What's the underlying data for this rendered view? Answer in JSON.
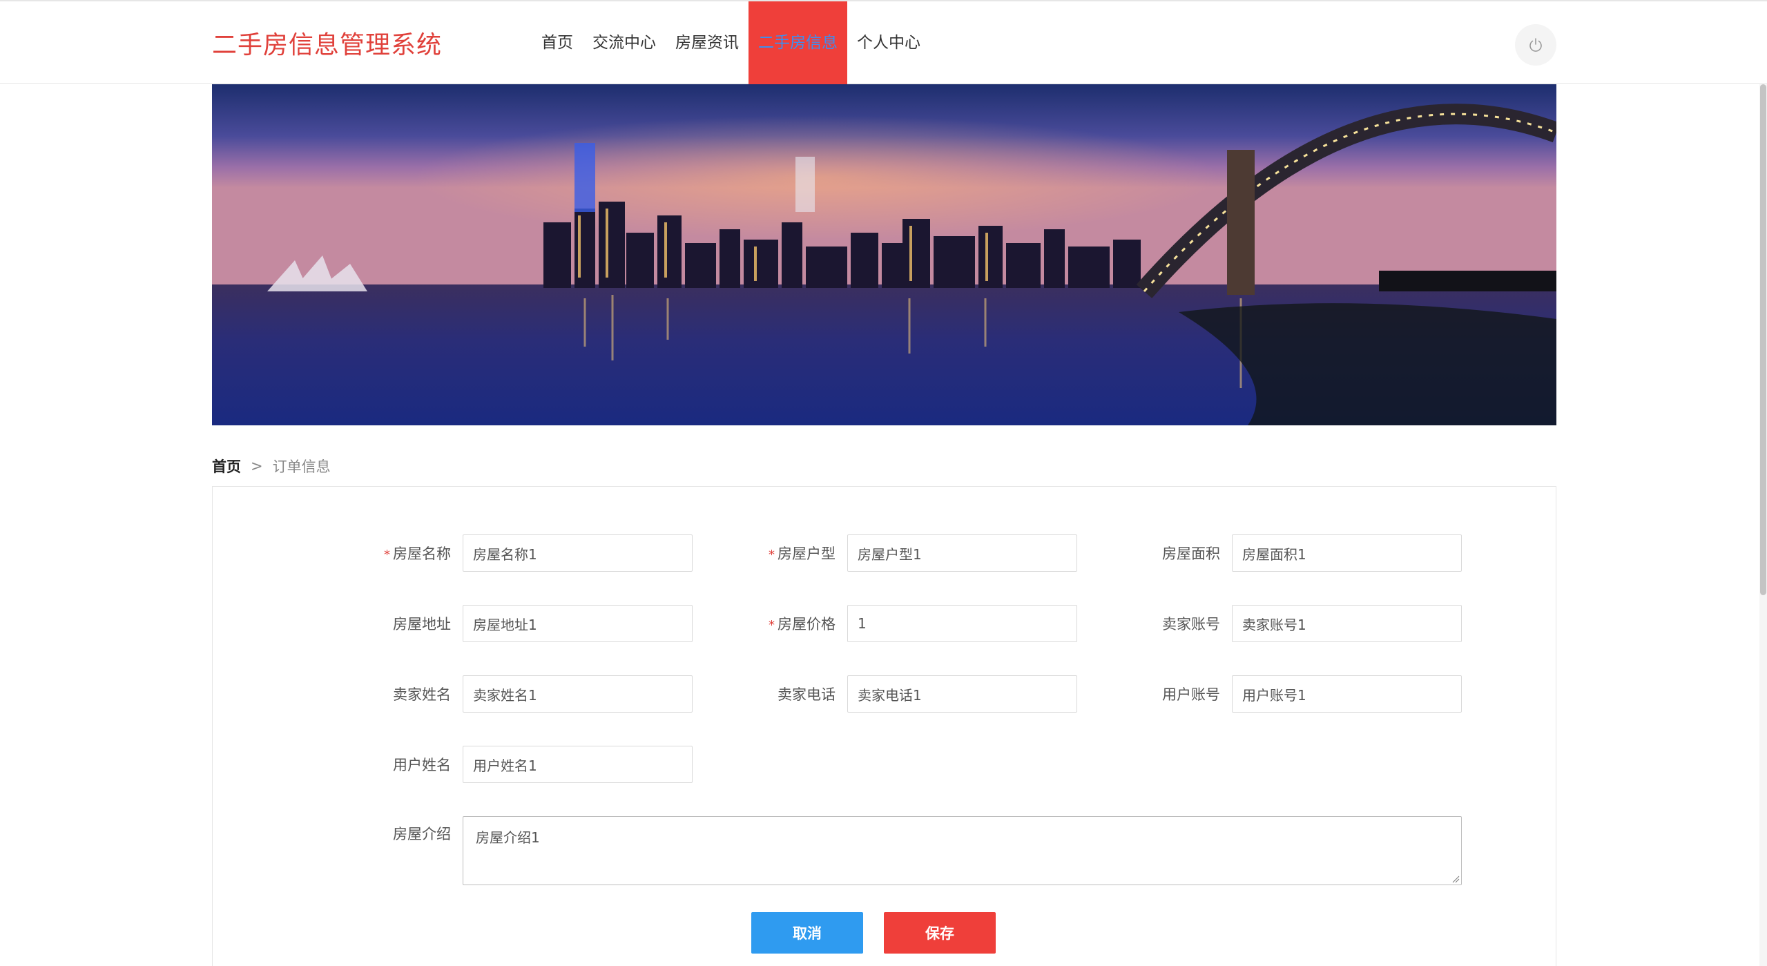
{
  "header": {
    "logo": "二手房信息管理系统",
    "nav": [
      {
        "label": "首页"
      },
      {
        "label": "交流中心"
      },
      {
        "label": "房屋资讯"
      },
      {
        "label": "二手房信息",
        "active": true
      },
      {
        "label": "个人中心"
      }
    ],
    "power_icon": "power-icon"
  },
  "banner": {
    "description_icon": "city-night-banner"
  },
  "breadcrumb": {
    "home": "首页",
    "separator": ">",
    "current": "订单信息"
  },
  "form": {
    "fields": [
      {
        "label": "房屋名称",
        "required": true,
        "value": "房屋名称1"
      },
      {
        "label": "房屋户型",
        "required": true,
        "value": "房屋户型1"
      },
      {
        "label": "房屋面积",
        "required": false,
        "value": "房屋面积1"
      },
      {
        "label": "房屋地址",
        "required": false,
        "value": "房屋地址1"
      },
      {
        "label": "房屋价格",
        "required": true,
        "value": "1"
      },
      {
        "label": "卖家账号",
        "required": false,
        "value": "卖家账号1"
      },
      {
        "label": "卖家姓名",
        "required": false,
        "value": "卖家姓名1"
      },
      {
        "label": "卖家电话",
        "required": false,
        "value": "卖家电话1"
      },
      {
        "label": "用户账号",
        "required": false,
        "value": "用户账号1"
      },
      {
        "label": "用户姓名",
        "required": false,
        "value": "用户姓名1"
      }
    ],
    "intro": {
      "label": "房屋介绍",
      "value": "房屋介绍1"
    },
    "cancel_label": "取消",
    "save_label": "保存"
  },
  "colors": {
    "brand_red": "#ef3f3a",
    "primary_blue": "#2f9bf0",
    "active_nav_text": "#3d8ef0"
  }
}
